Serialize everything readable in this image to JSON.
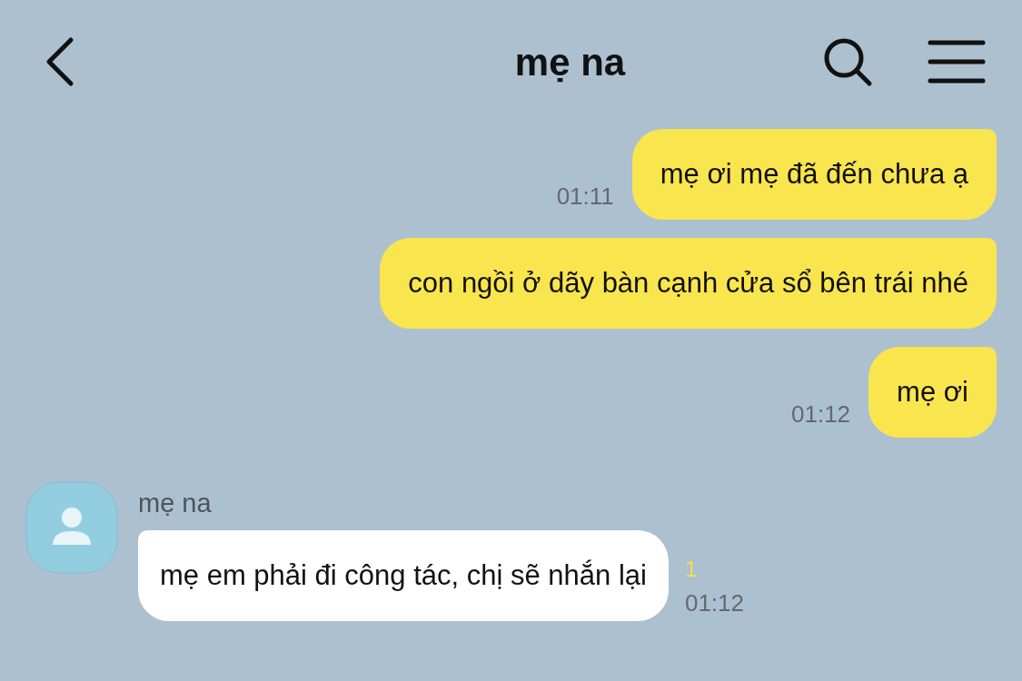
{
  "header": {
    "title": "mẹ na"
  },
  "messages": [
    {
      "kind": "out",
      "text": "mẹ ơi mẹ đã đến chưa ạ",
      "time": "01:11"
    },
    {
      "kind": "out",
      "text": "con ngồi ở dãy bàn cạnh cửa sổ bên trái nhé"
    },
    {
      "kind": "out",
      "text": "mẹ ơi",
      "time": "01:12"
    },
    {
      "kind": "in",
      "sender": "mẹ na",
      "text": "mẹ em phải đi công tác, chị sẽ nhắn lại",
      "unread": "1",
      "time": "01:12"
    }
  ]
}
